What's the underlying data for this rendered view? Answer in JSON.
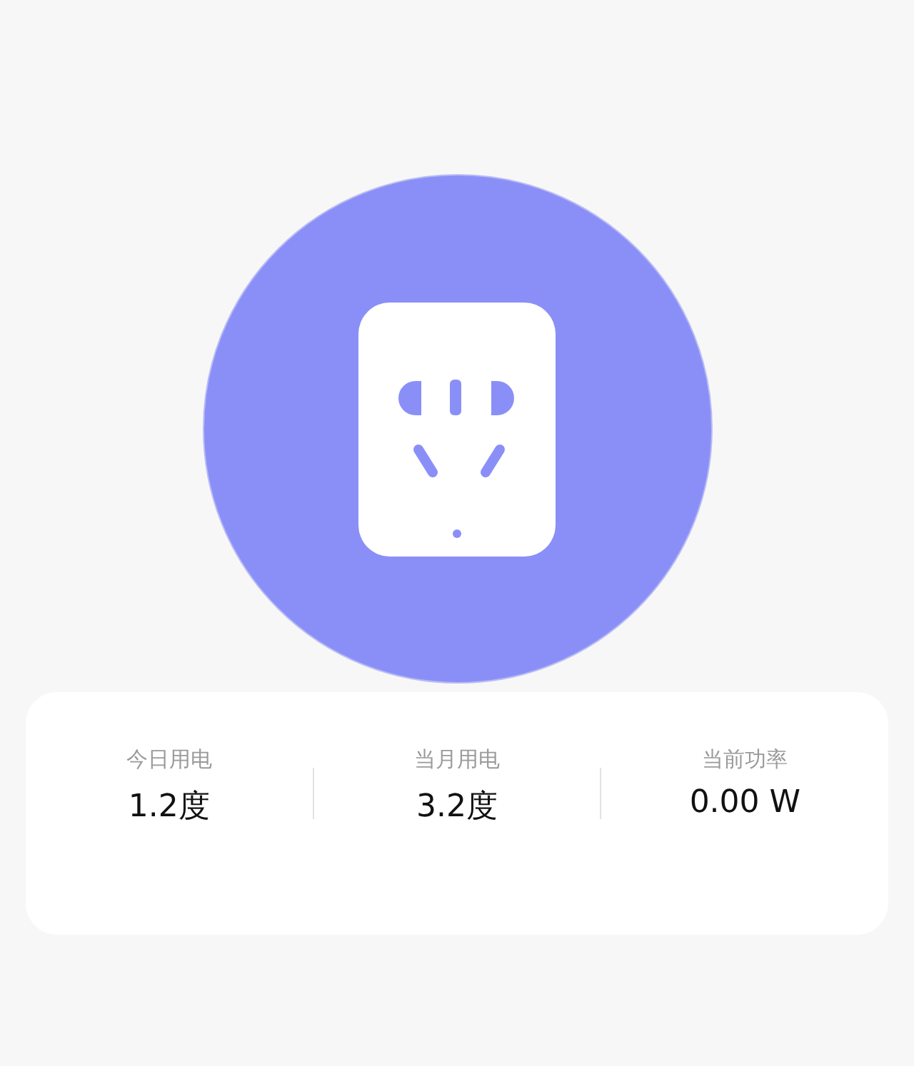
{
  "stats": [
    {
      "label": "今日用电",
      "value": "1.2度"
    },
    {
      "label": "当月用电",
      "value": "3.2度"
    },
    {
      "label": "当前功率",
      "value": "0.00 W"
    }
  ]
}
